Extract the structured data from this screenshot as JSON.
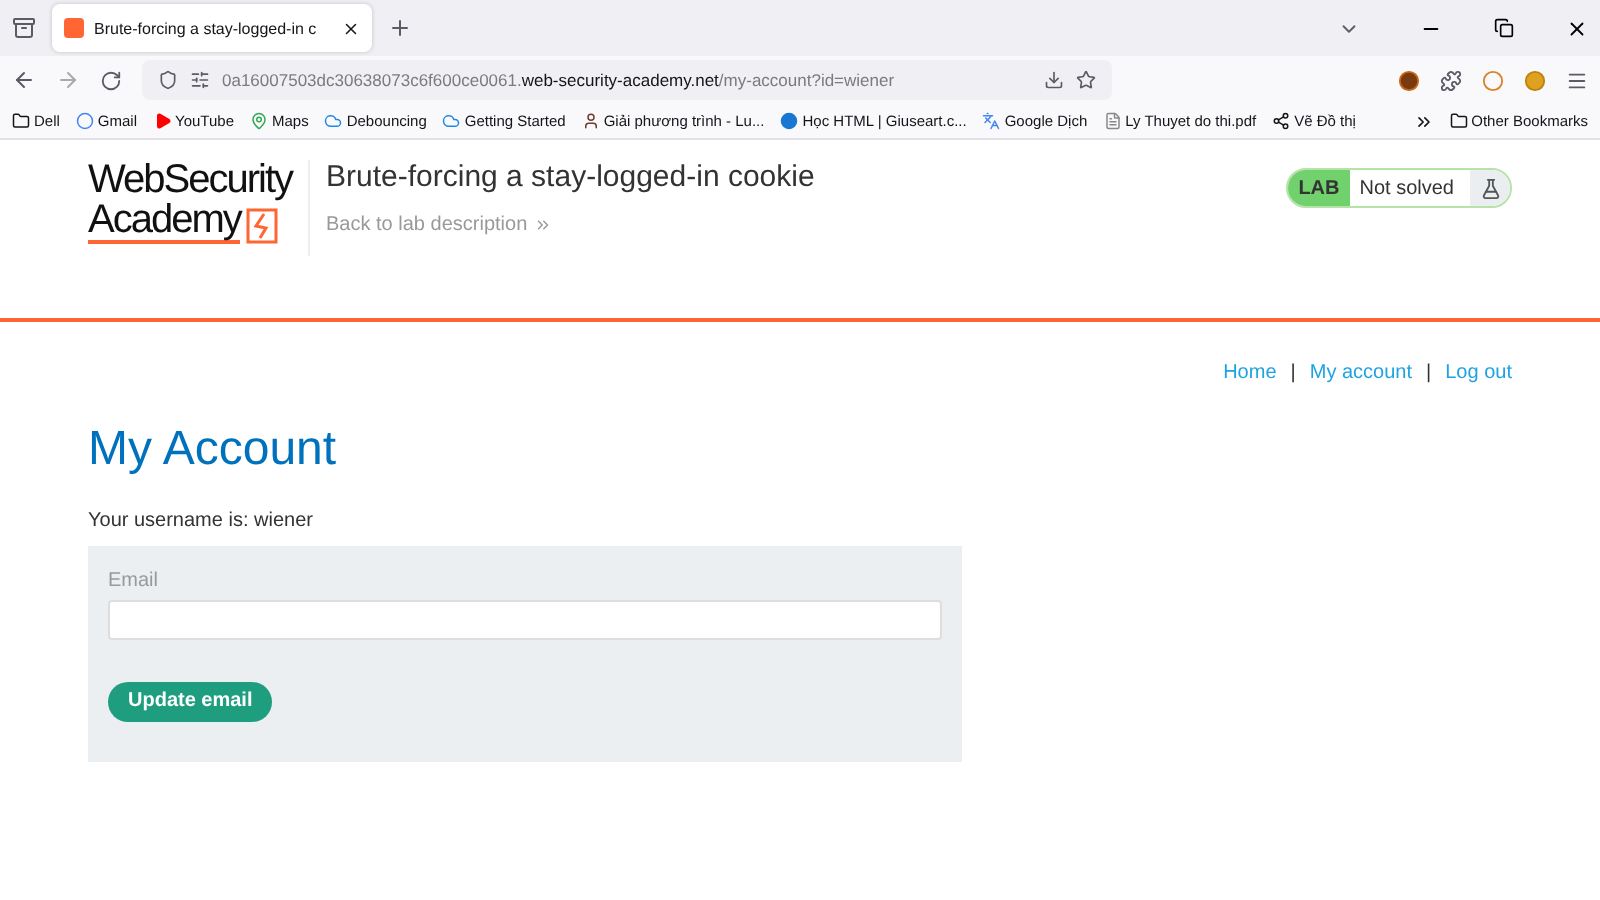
{
  "browser": {
    "tab": {
      "title": "Brute-forcing a stay-logged-in c"
    },
    "url": {
      "subdomain": "0a16007503dc30638073c6f600ce0061.",
      "domain": "web-security-academy.net",
      "path": "/my-account?id=wiener"
    },
    "bookmarks": [
      {
        "label": "Dell",
        "kind": "folder"
      },
      {
        "label": "Gmail",
        "kind": "g"
      },
      {
        "label": "YouTube",
        "kind": "play"
      },
      {
        "label": "Maps",
        "kind": "pin"
      },
      {
        "label": "Debouncing",
        "kind": "cloud"
      },
      {
        "label": "Getting Started",
        "kind": "cloud"
      },
      {
        "label": "Giải phương trình - Lu...",
        "kind": "person"
      },
      {
        "label": "Học HTML | Giuseart.c...",
        "kind": "circle"
      },
      {
        "label": "Google Dịch",
        "kind": "translate"
      },
      {
        "label": "Ly Thuyet do thi.pdf",
        "kind": "file"
      },
      {
        "label": "Vẽ Đồ thị",
        "kind": "graph"
      }
    ],
    "other_bookmarks": "Other Bookmarks"
  },
  "header": {
    "logo_line_1": "WebSecurity",
    "logo_line_2": "Academy",
    "lab_title": "Brute-forcing a stay-logged-in cookie",
    "back_link": "Back to lab description",
    "lab_badge": "LAB",
    "lab_status": "Not solved"
  },
  "nav": [
    {
      "label": "Home"
    },
    {
      "label": "My account"
    },
    {
      "label": "Log out"
    }
  ],
  "nav_separator": "|",
  "page": {
    "heading": "My Account",
    "username_text": "Your username is: wiener",
    "email_label": "Email",
    "button": "Update email"
  }
}
